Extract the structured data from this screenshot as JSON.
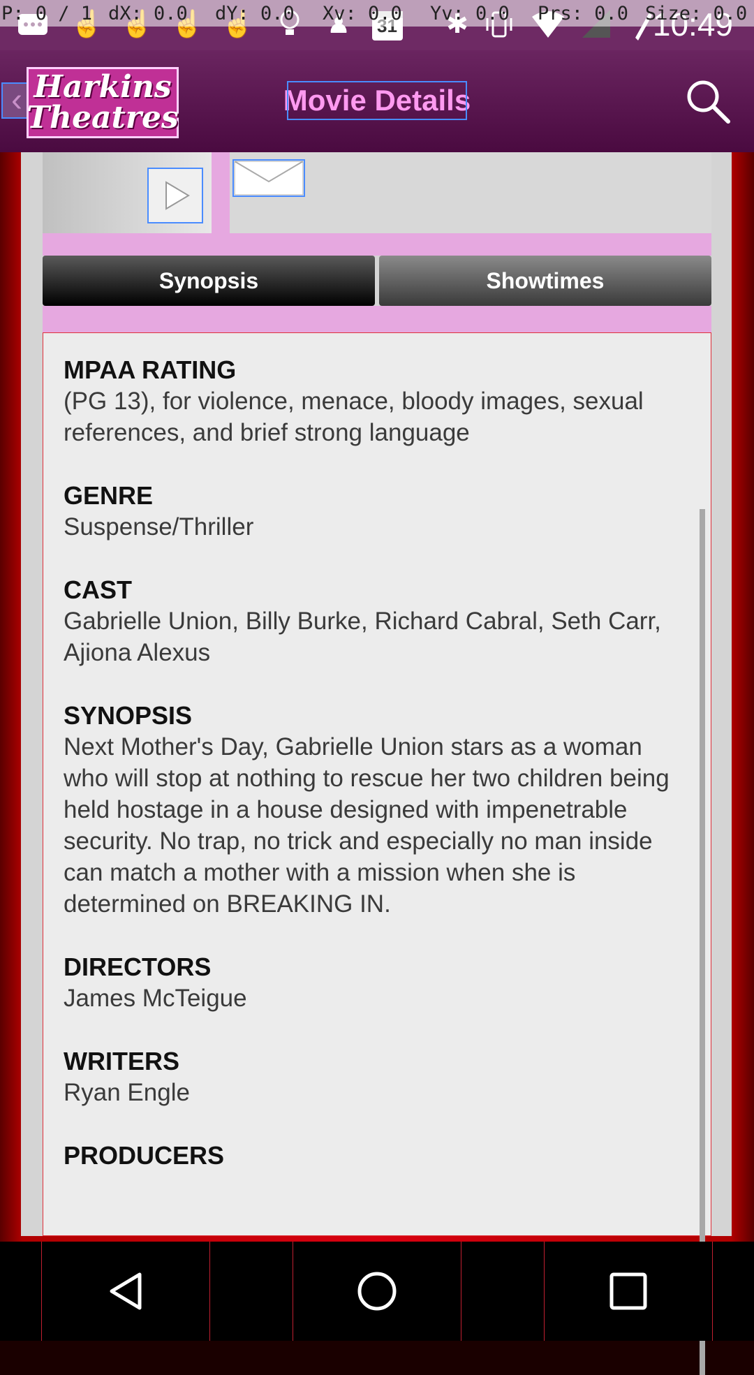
{
  "status_bar": {
    "debug": {
      "p": "P: 0 / 1",
      "dx": "dX: 0.0",
      "dy": "dY: 0.0",
      "xv": "Xv: 0.0",
      "yv": "Yv: 0.0",
      "prs": "Prs: 0.0",
      "size": "Size: 0.0"
    },
    "calendar_day": "31",
    "time": "10:49"
  },
  "header": {
    "logo_line1": "Harkins",
    "logo_line2": "Theatres",
    "title": "Movie Details"
  },
  "tabs": [
    {
      "label": "Synopsis",
      "active": true
    },
    {
      "label": "Showtimes",
      "active": false
    }
  ],
  "details": {
    "mpaa": {
      "label": "MPAA RATING",
      "value": "(PG 13), for violence, menace, bloody images, sexual references, and brief strong language"
    },
    "genre": {
      "label": "GENRE",
      "value": "Suspense/Thriller"
    },
    "cast": {
      "label": "CAST",
      "value": "Gabrielle Union, Billy Burke, Richard Cabral, Seth Carr, Ajiona Alexus"
    },
    "synopsis": {
      "label": "SYNOPSIS",
      "value": "Next Mother's Day, Gabrielle Union stars as a woman who will stop at nothing to rescue her two children being held hostage in a house designed with impenetrable security. No trap, no trick and especially no man inside can match a mother with a mission when she is determined on BREAKING IN."
    },
    "directors": {
      "label": "DIRECTORS",
      "value": "James McTeigue"
    },
    "writers": {
      "label": "WRITERS",
      "value": "Ryan Engle"
    },
    "producers": {
      "label": "PRODUCERS",
      "value": ""
    }
  },
  "colors": {
    "header": "#5a1550",
    "title": "#ff9af0",
    "accent_pink": "#e6a8e0",
    "frame_red": "#d80010"
  }
}
